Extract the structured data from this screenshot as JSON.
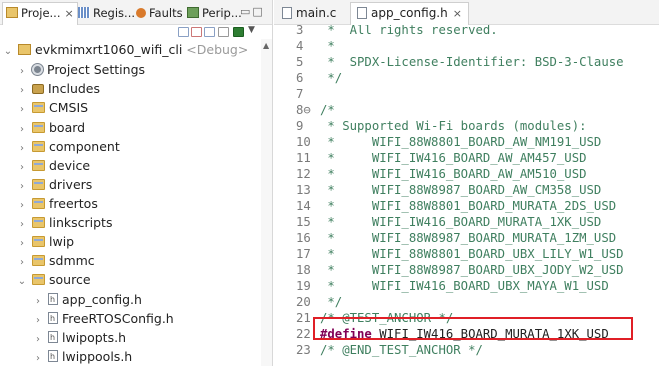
{
  "left_panel": {
    "tabs": [
      {
        "label": "Proje...",
        "active": true,
        "close": "×"
      },
      {
        "label": "Regis...",
        "active": false
      },
      {
        "label": "Faults",
        "active": false
      },
      {
        "label": "Perip...",
        "active": false
      }
    ],
    "project": {
      "name": "evkmimxrt1060_wifi_cli",
      "config": "<Debug>"
    },
    "tree": [
      {
        "label": "Project Settings",
        "icon": "gear-icon",
        "expanded": false
      },
      {
        "label": "Includes",
        "icon": "includes-icon",
        "expanded": false
      },
      {
        "label": "CMSIS",
        "icon": "folder-icon",
        "expanded": false
      },
      {
        "label": "board",
        "icon": "folder-icon",
        "expanded": false
      },
      {
        "label": "component",
        "icon": "folder-icon",
        "expanded": false
      },
      {
        "label": "device",
        "icon": "folder-icon",
        "expanded": false
      },
      {
        "label": "drivers",
        "icon": "folder-icon",
        "expanded": false
      },
      {
        "label": "freertos",
        "icon": "folder-icon",
        "expanded": false
      },
      {
        "label": "linkscripts",
        "icon": "folder-icon",
        "expanded": false
      },
      {
        "label": "lwip",
        "icon": "folder-icon",
        "expanded": false
      },
      {
        "label": "sdmmc",
        "icon": "folder-icon",
        "expanded": false
      },
      {
        "label": "source",
        "icon": "folder-icon",
        "expanded": true
      },
      {
        "label": "app_config.h",
        "icon": "header-file-icon",
        "expanded": false
      },
      {
        "label": "FreeRTOSConfig.h",
        "icon": "header-file-icon",
        "expanded": false
      },
      {
        "label": "lwipopts.h",
        "icon": "header-file-icon",
        "expanded": false
      },
      {
        "label": "lwippools.h",
        "icon": "header-file-icon",
        "expanded": false
      }
    ]
  },
  "editor": {
    "tabs": [
      {
        "label": "main.c",
        "active": false
      },
      {
        "label": "app_config.h",
        "active": true,
        "close": "×"
      }
    ],
    "lines": [
      {
        "n": "3",
        "text": " *  All rights reserved.",
        "kind": "comment"
      },
      {
        "n": "4",
        "text": " *",
        "kind": "comment"
      },
      {
        "n": "5",
        "text": " *  SPDX-License-Identifier: BSD-3-Clause",
        "kind": "comment"
      },
      {
        "n": "6",
        "text": " */",
        "kind": "comment"
      },
      {
        "n": "7",
        "text": "",
        "kind": "comment"
      },
      {
        "n": "8⊖",
        "text": "/*",
        "kind": "comment"
      },
      {
        "n": "9",
        "text": " * Supported Wi-Fi boards (modules):",
        "kind": "comment"
      },
      {
        "n": "10",
        "text": " *     WIFI_88W8801_BOARD_AW_NM191_USD",
        "kind": "comment"
      },
      {
        "n": "11",
        "text": " *     WIFI_IW416_BOARD_AW_AM457_USD",
        "kind": "comment"
      },
      {
        "n": "12",
        "text": " *     WIFI_IW416_BOARD_AW_AM510_USD",
        "kind": "comment"
      },
      {
        "n": "13",
        "text": " *     WIFI_88W8987_BOARD_AW_CM358_USD",
        "kind": "comment"
      },
      {
        "n": "14",
        "text": " *     WIFI_88W8801_BOARD_MURATA_2DS_USD",
        "kind": "comment"
      },
      {
        "n": "15",
        "text": " *     WIFI_IW416_BOARD_MURATA_1XK_USD",
        "kind": "comment"
      },
      {
        "n": "16",
        "text": " *     WIFI_88W8987_BOARD_MURATA_1ZM_USD",
        "kind": "comment"
      },
      {
        "n": "17",
        "text": " *     WIFI_88W8801_BOARD_UBX_LILY_W1_USD",
        "kind": "comment"
      },
      {
        "n": "18",
        "text": " *     WIFI_88W8987_BOARD_UBX_JODY_W2_USD",
        "kind": "comment"
      },
      {
        "n": "19",
        "text": " *     WIFI_IW416_BOARD_UBX_MAYA_W1_USD",
        "kind": "comment"
      },
      {
        "n": "20",
        "text": " */",
        "kind": "comment"
      },
      {
        "n": "21",
        "text": "/* @TEST_ANCHOR */",
        "kind": "comment"
      },
      {
        "n": "22",
        "keyword": "#define",
        "text": " WIFI_IW416_BOARD_MURATA_1XK_USD",
        "kind": "define"
      },
      {
        "n": "23",
        "text": "/* @END_TEST_ANCHOR */",
        "kind": "comment"
      }
    ]
  },
  "colors": {
    "highlight_box": "#e01f26",
    "comment": "#3f7f5f",
    "keyword": "#7f0055"
  }
}
